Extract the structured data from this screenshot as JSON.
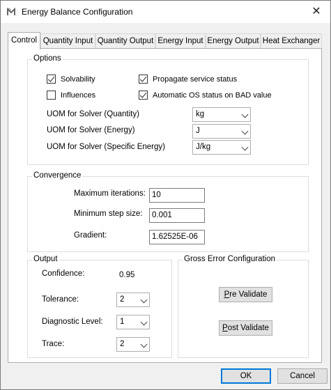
{
  "window": {
    "title": "Energy Balance Configuration",
    "close_symbol": "✕"
  },
  "tabs": [
    {
      "label": "Control",
      "active": true
    },
    {
      "label": "Quantity Input",
      "active": false
    },
    {
      "label": "Quantity Output",
      "active": false
    },
    {
      "label": "Energy Input",
      "active": false
    },
    {
      "label": "Energy Output",
      "active": false
    },
    {
      "label": "Heat Exchanger",
      "active": false
    }
  ],
  "options": {
    "group_label": "Options",
    "checkboxes": [
      {
        "label": "Solvability",
        "checked": true
      },
      {
        "label": "Propagate service status",
        "checked": true
      },
      {
        "label": "Influences",
        "checked": false
      },
      {
        "label": "Automatic OS status on BAD value",
        "checked": true
      }
    ],
    "uom": [
      {
        "label": "UOM for Solver (Quantity)",
        "value": "kg"
      },
      {
        "label": "UOM for Solver (Energy)",
        "value": "J"
      },
      {
        "label": "UOM for Solver (Specific Energy)",
        "value": "J/kg"
      }
    ]
  },
  "convergence": {
    "group_label": "Convergence",
    "fields": [
      {
        "label": "Maximum iterations:",
        "value": "10"
      },
      {
        "label": "Minimum step size:",
        "value": "0.001"
      },
      {
        "label": "Gradient:",
        "value": "1.62525E-06"
      }
    ]
  },
  "output": {
    "group_label": "Output",
    "confidence_label": "Confidence:",
    "confidence_value": "0.95",
    "tolerance_label": "Tolerance:",
    "tolerance_value": "2",
    "diagnostic_label": "Diagnostic Level:",
    "diagnostic_value": "1",
    "trace_label": "Trace:",
    "trace_value": "2"
  },
  "gross_error": {
    "group_label": "Gross Error Configuration",
    "pre_validate_mnemonic": "P",
    "pre_validate_rest": "re Validate",
    "post_validate_mnemonic": "P",
    "post_validate_rest": "ost Validate"
  },
  "footer": {
    "ok_label": "OK",
    "cancel_label": "Cancel"
  },
  "colors": {
    "accent": "#0078d7",
    "window_bg": "#f0f0f0",
    "panel_bg": "#ffffff"
  },
  "icons": {
    "app": "app-logo-icon",
    "close": "close-icon",
    "checkmark": "checkmark-icon",
    "dropdown": "chevron-down-icon"
  }
}
